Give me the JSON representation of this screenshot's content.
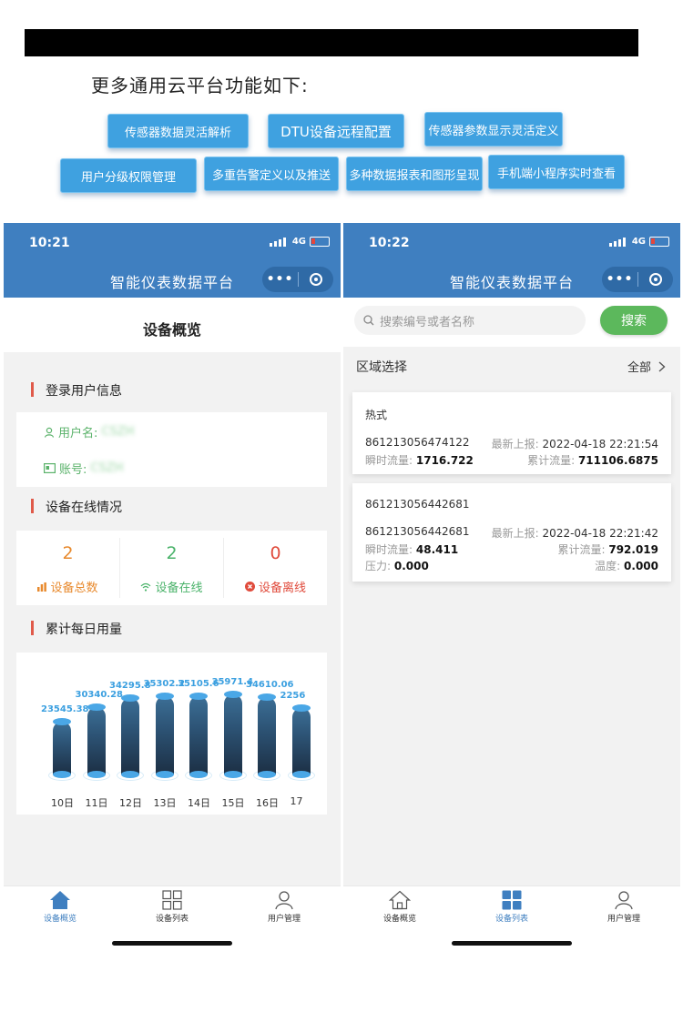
{
  "banner": {
    "title": "更多通用云平台功能如下:",
    "features": [
      "传感器数据灵活解析",
      "DTU设备远程配置",
      "传感器参数显示灵活定义",
      "用户分级权限管理",
      "多重告警定义以及推送",
      "多种数据报表和图形呈现",
      "手机端小程序实时查看"
    ]
  },
  "left_phone": {
    "status": {
      "time": "10:21",
      "network": "4G"
    },
    "app_title": "智能仪表数据平台",
    "capsule_dots": "•••",
    "page_title": "设备概览",
    "sections": {
      "user_info": "登录用户信息",
      "online": "设备在线情况",
      "daily": "累计每日用量"
    },
    "user": {
      "username_label": "用户名:",
      "username_value": "CSZH",
      "account_label": "账号:",
      "account_value": "CSZH"
    },
    "stats": [
      {
        "value": "2",
        "label": "设备总数",
        "color": "#e88a2e"
      },
      {
        "value": "2",
        "label": "设备在线",
        "color": "#4bb36b"
      },
      {
        "value": "0",
        "label": "设备离线",
        "color": "#e04b3c"
      }
    ],
    "chart_data": {
      "type": "bar",
      "categories": [
        "10日",
        "11日",
        "12日",
        "13日",
        "14日",
        "15日",
        "16日",
        "17"
      ],
      "values": [
        23545.38,
        30340.28,
        34295.8,
        35302.2,
        35105.6,
        35971.4,
        34610.06,
        2256
      ],
      "value_labels": [
        "23545.38",
        "30340.28",
        "34295.8",
        "35302.2",
        "35105.6",
        "35971.4",
        "34610.06",
        "2256"
      ],
      "bar_color": "#2d5476",
      "label_color": "#3ca0e0"
    },
    "tabs": [
      "设备概览",
      "设备列表",
      "用户管理"
    ]
  },
  "right_phone": {
    "status": {
      "time": "10:22",
      "network": "4G"
    },
    "app_title": "智能仪表数据平台",
    "capsule_dots": "•••",
    "search": {
      "placeholder": "搜索编号或者名称",
      "button": "搜索"
    },
    "region": {
      "label": "区域选择",
      "value": "全部"
    },
    "devices": [
      {
        "name": "热式",
        "id": "861213056474122",
        "report_label": "最新上报:",
        "report_time": "2022-04-18 22:21:54",
        "flow_label": "瞬时流量:",
        "flow_value": "1716.722",
        "total_label": "累计流量:",
        "total_value": "711106.6875"
      },
      {
        "name": "861213056442681",
        "id": "861213056442681",
        "report_label": "最新上报:",
        "report_time": "2022-04-18 22:21:42",
        "flow_label": "瞬时流量:",
        "flow_value": "48.411",
        "total_label": "累计流量:",
        "total_value": "792.019",
        "pressure_label": "压力:",
        "pressure_value": "0.000",
        "temp_label": "温度:",
        "temp_value": "0.000"
      }
    ],
    "tabs": [
      "设备概览",
      "设备列表",
      "用户管理"
    ]
  },
  "colors": {
    "header": "#3f7fc0",
    "accent_blue": "#3fa1e0",
    "search_green": "#5cb85c",
    "section_mark": "#e05a4a"
  }
}
